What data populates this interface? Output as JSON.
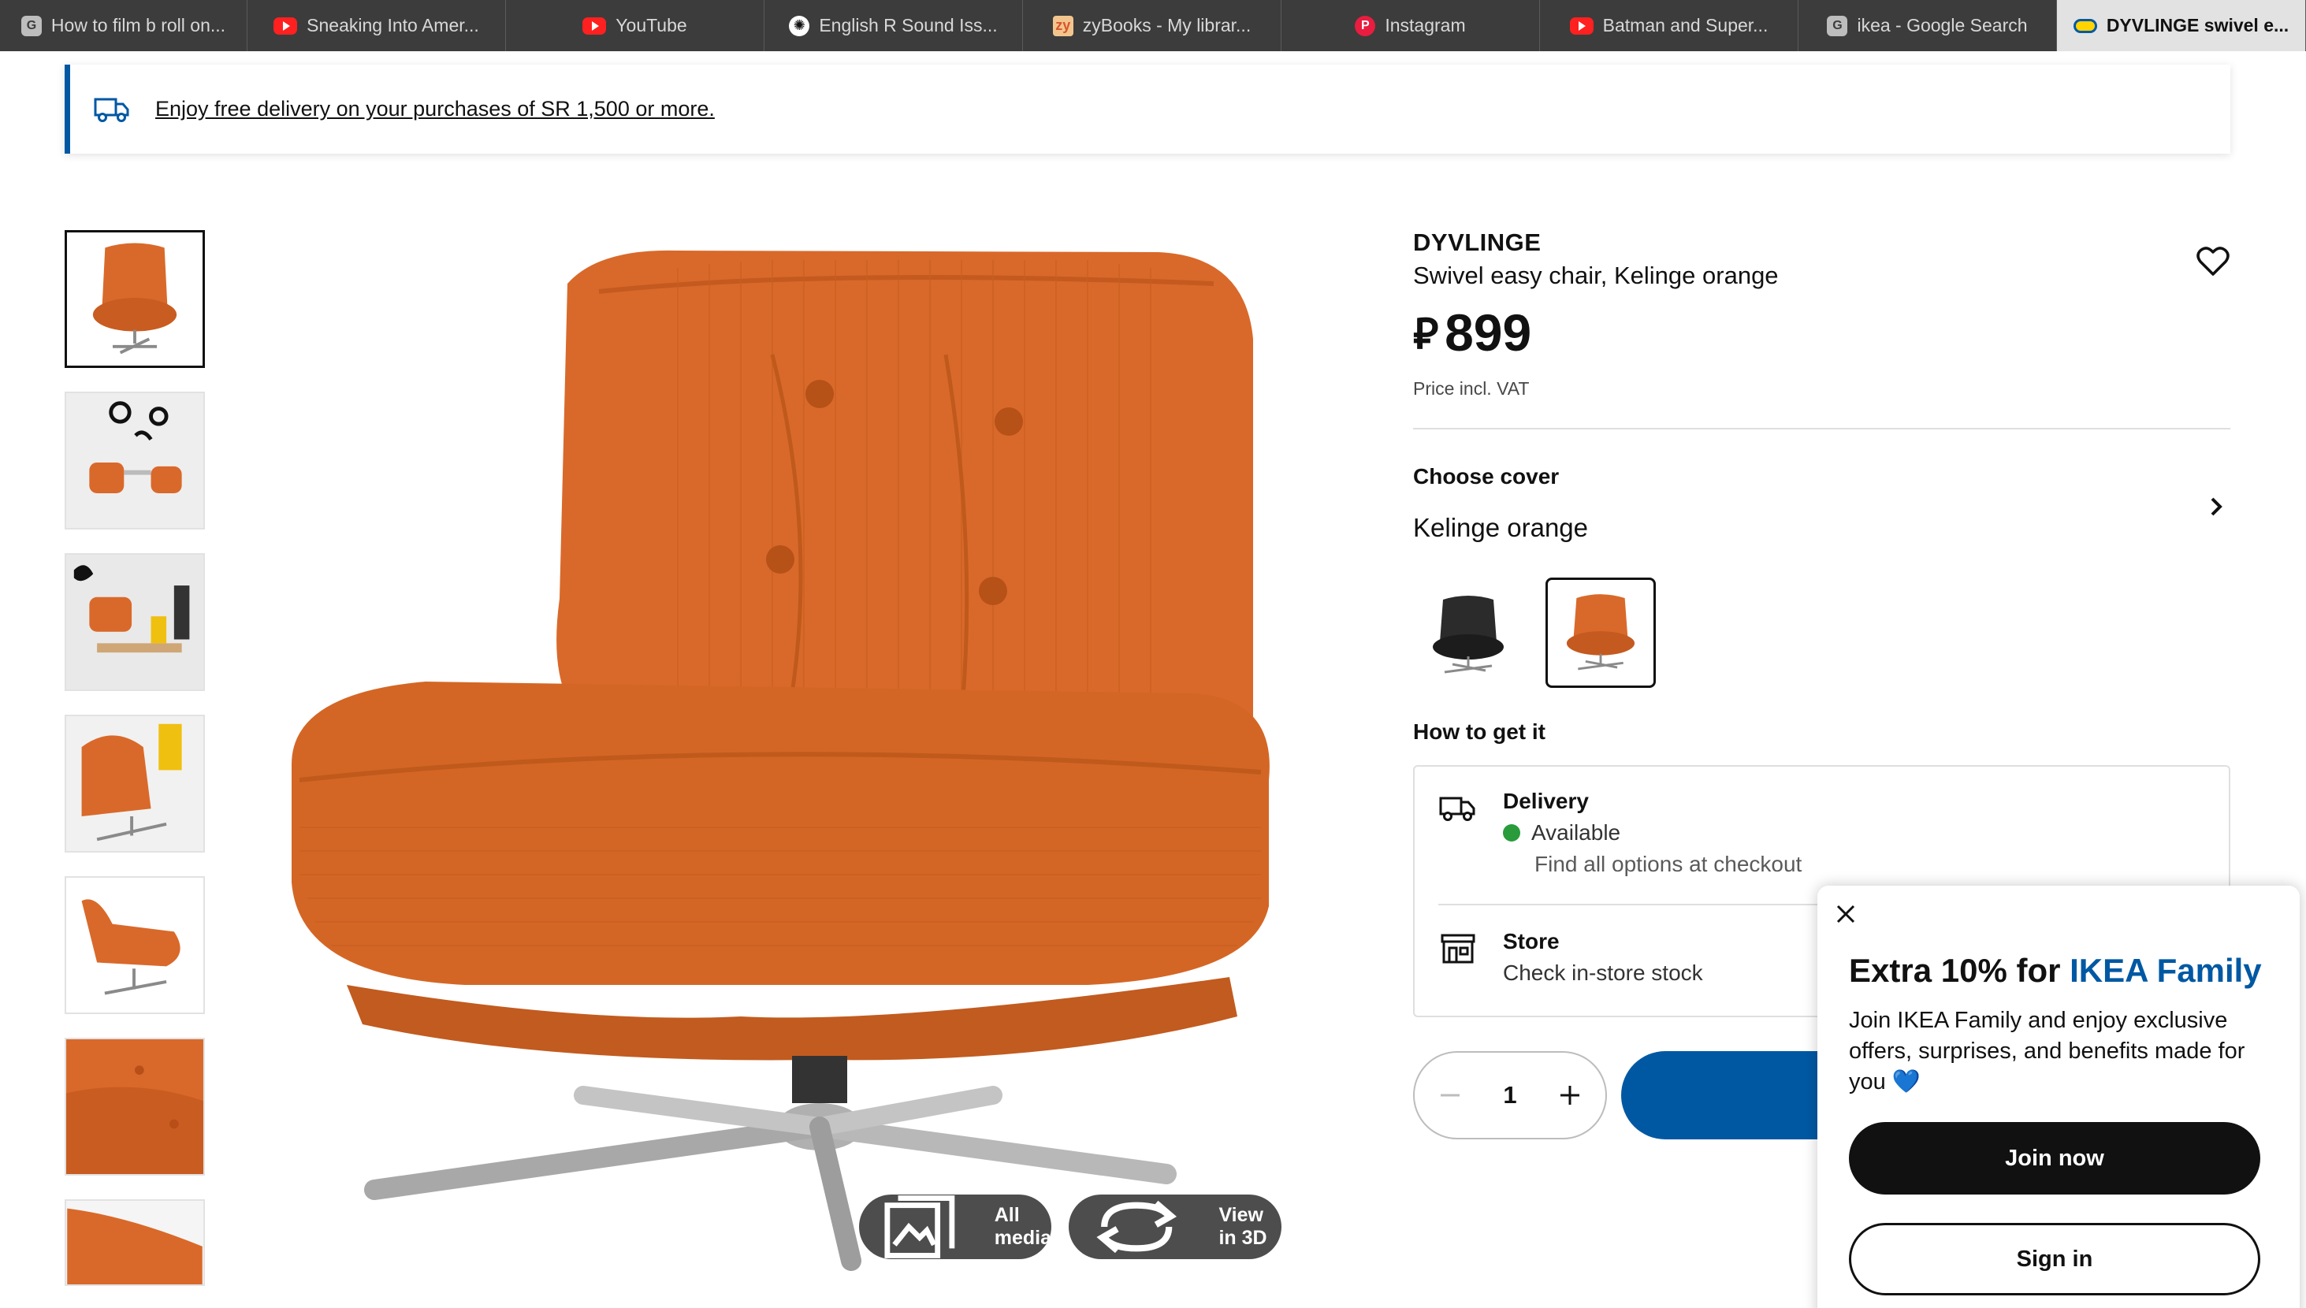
{
  "browser": {
    "tabs": [
      {
        "label": "How to film b roll on...",
        "icon": "google-icon",
        "favicon_text": "G"
      },
      {
        "label": "Sneaking Into Amer...",
        "icon": "youtube-icon"
      },
      {
        "label": "YouTube",
        "icon": "youtube-icon"
      },
      {
        "label": "English R Sound Iss...",
        "icon": "chatgpt-icon",
        "favicon_text": "✺"
      },
      {
        "label": "zyBooks - My librar...",
        "icon": "zybooks-icon",
        "favicon_text": "zy"
      },
      {
        "label": "Instagram",
        "icon": "pinterest-icon",
        "favicon_text": "P"
      },
      {
        "label": "Batman and Super...",
        "icon": "youtube-icon"
      },
      {
        "label": "ikea - Google Search",
        "icon": "google-icon",
        "favicon_text": "G"
      },
      {
        "label": "DYVLINGE swivel e...",
        "icon": "ikea-icon",
        "active": true
      }
    ]
  },
  "banner": {
    "icon": "delivery-truck-icon",
    "text": "Enjoy free delivery on your purchases of SR 1,500 or more."
  },
  "gallery": {
    "selected_index": 0,
    "thumbnail_count": 7,
    "buttons": {
      "all_media": "All media",
      "view_3d": "View in 3D"
    }
  },
  "product": {
    "name": "DYVLINGE",
    "description": "Swivel easy chair, Kelinge orange",
    "currency_symbol": "⃁",
    "price": "899",
    "price_note": "Price incl. VAT",
    "cover_label": "Choose cover",
    "cover_value": "Kelinge orange",
    "swatches": [
      {
        "name": "black",
        "color": "#2b2b2b",
        "selected": false
      },
      {
        "name": "kelinge-orange",
        "color": "#d9692a",
        "selected": true
      }
    ],
    "how_to_get_label": "How to get it",
    "delivery": {
      "title": "Delivery",
      "status": "Available",
      "status_color": "#2a9b3a",
      "note": "Find all options at checkout"
    },
    "store": {
      "title": "Store",
      "note": "Check in-store stock"
    },
    "quantity": "1"
  },
  "popup": {
    "title_prefix": "Extra 10% for ",
    "title_brand": "IKEA Family",
    "body": "Join IKEA Family and enjoy exclusive offers, surprises, and benefits made for you",
    "body_emoji": "💙",
    "join_label": "Join now",
    "signin_label": "Sign in"
  },
  "colors": {
    "accent": "#0058a3",
    "chair_orange": "#d9692a",
    "tab_bar": "#3c3c3c",
    "available_green": "#2a9b3a"
  }
}
